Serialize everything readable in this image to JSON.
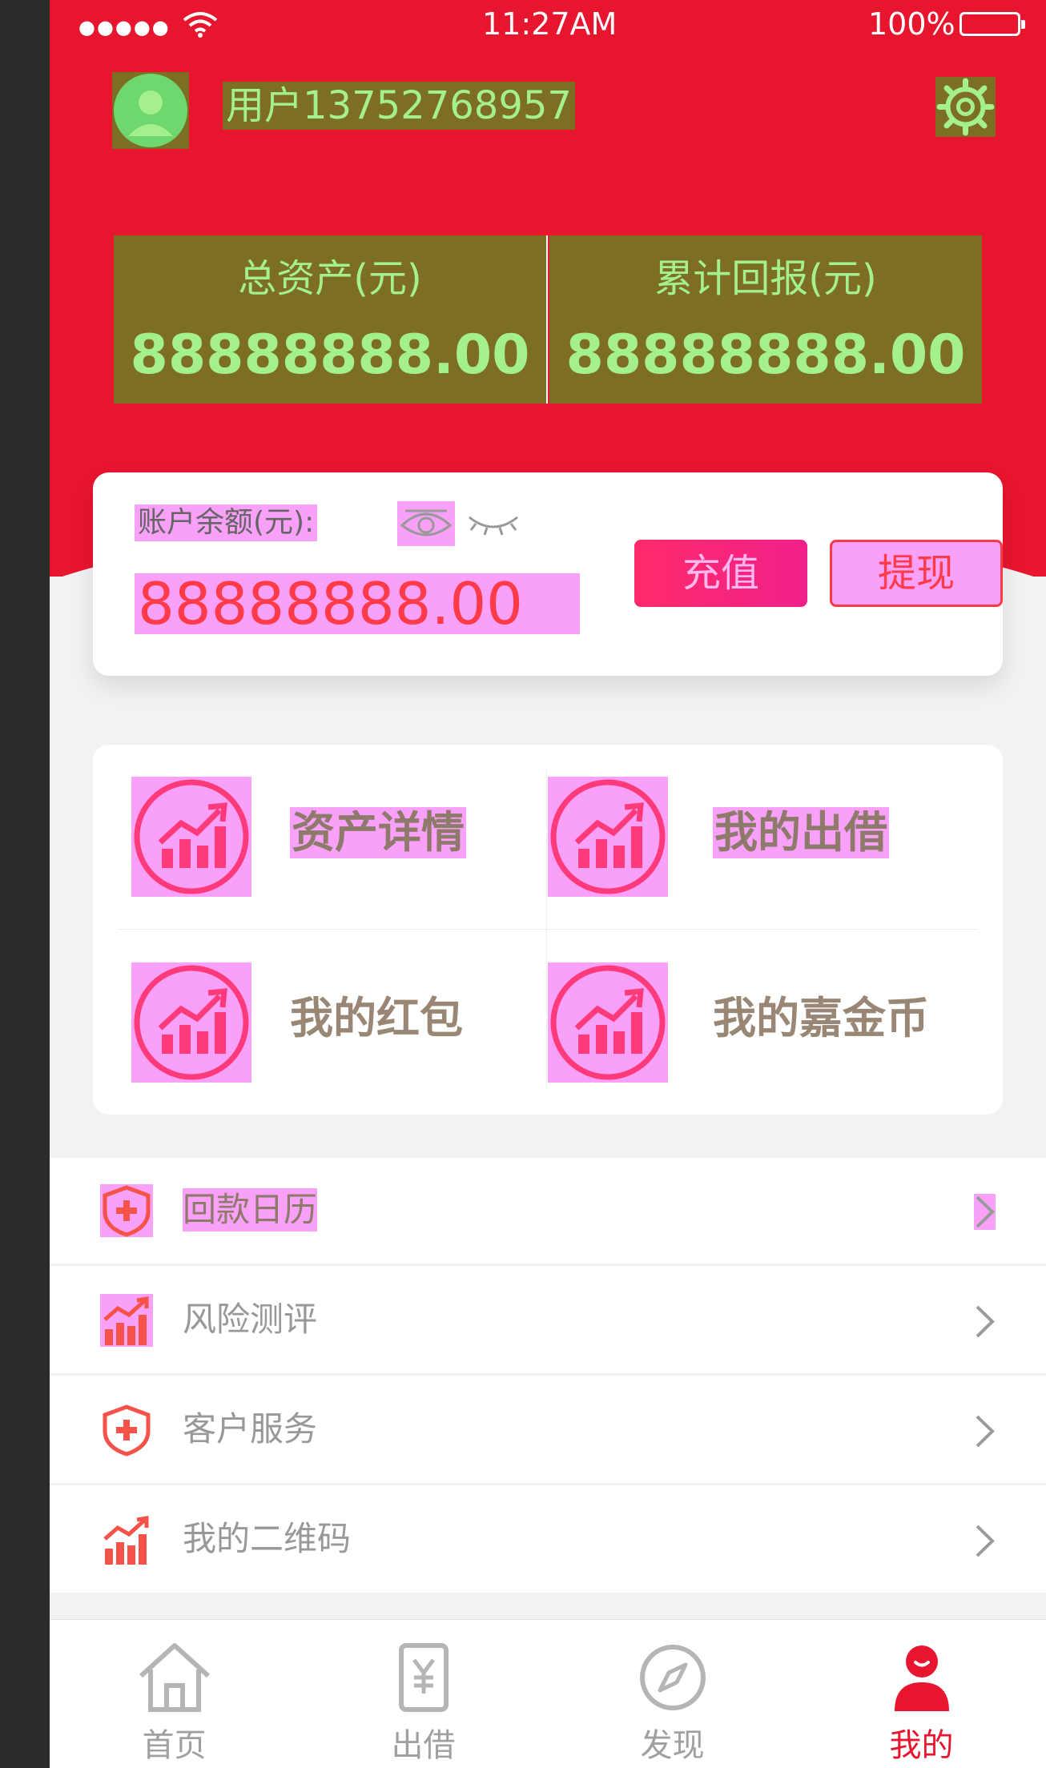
{
  "status_bar": {
    "signal": "●●●●●",
    "time": "11:27AM",
    "battery": "100%"
  },
  "header": {
    "username": "用户13752768957",
    "total_assets_label": "总资产(元)",
    "total_assets_value": "88888888.00",
    "total_return_label": "累计回报(元)",
    "total_return_value": "88888888.00"
  },
  "balance": {
    "label": "账户余额(元):",
    "value": "88888888.00",
    "recharge_label": "充值",
    "withdraw_label": "提现"
  },
  "grid": {
    "items": [
      {
        "label": "资产详情",
        "icon": "chart-up-icon"
      },
      {
        "label": "我的出借",
        "icon": "chart-up-icon"
      },
      {
        "label": "我的红包",
        "icon": "chart-up-icon"
      },
      {
        "label": "我的嘉金币",
        "icon": "chart-up-icon"
      }
    ]
  },
  "list": {
    "items": [
      {
        "label": "回款日历",
        "icon": "shield-plus-icon"
      },
      {
        "label": "风险测评",
        "icon": "chart-up-icon"
      },
      {
        "label": "客户服务",
        "icon": "shield-plus-icon"
      },
      {
        "label": "我的二维码",
        "icon": "chart-up-icon"
      }
    ]
  },
  "tabbar": {
    "tabs": [
      {
        "label": "首页",
        "icon": "home-icon"
      },
      {
        "label": "出借",
        "icon": "yuan-doc-icon"
      },
      {
        "label": "发现",
        "icon": "compass-icon"
      },
      {
        "label": "我的",
        "icon": "user-icon",
        "active": true
      }
    ]
  },
  "colors": {
    "brand_red": "#e8152f",
    "accent": "#ff3a49",
    "text_gray": "#989898",
    "grid_text": "#998675"
  }
}
